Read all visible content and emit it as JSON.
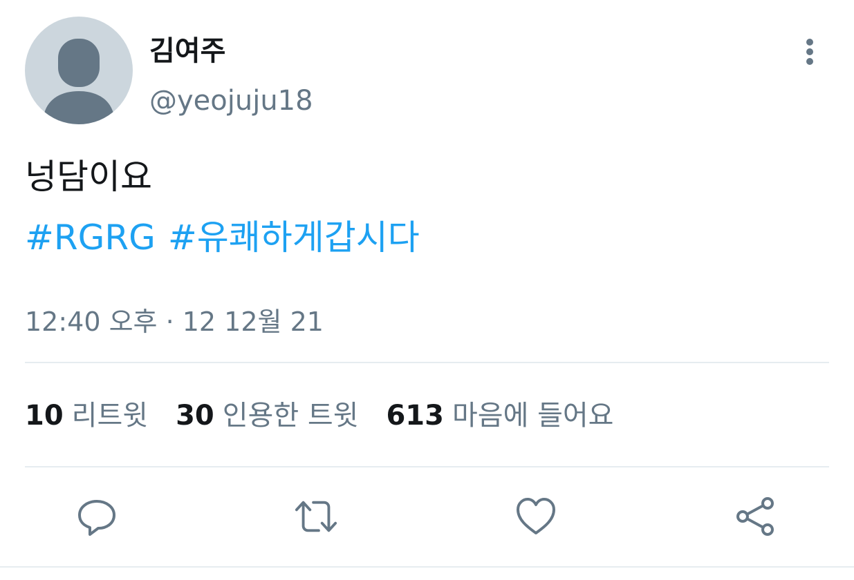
{
  "tweet": {
    "author": {
      "display_name": "김여주",
      "handle": "@yeojuju18",
      "avatar_icon": "default-avatar-icon"
    },
    "text": "넝담이요",
    "hashtags": [
      "#RGRG",
      "#유쾌하게갑시다"
    ],
    "timestamp": "12:40 오후 · 12 12월 21",
    "stats": {
      "retweets": {
        "count": "10",
        "label": "리트윗"
      },
      "quotes": {
        "count": "30",
        "label": "인용한 트윗"
      },
      "likes": {
        "count": "613",
        "label": "마음에 들어요"
      }
    }
  },
  "actions": {
    "reply_icon": "reply-icon",
    "retweet_icon": "retweet-icon",
    "like_icon": "heart-icon",
    "share_icon": "share-icon",
    "more_icon": "more-vertical-icon"
  },
  "colors": {
    "hashtag": "#1da1f2",
    "secondary_text": "#657786",
    "primary_text": "#14171a",
    "icon": "#657786",
    "avatar_bg": "#ccd6dd",
    "avatar_figure": "#657786",
    "divider": "#e6ecf0"
  }
}
